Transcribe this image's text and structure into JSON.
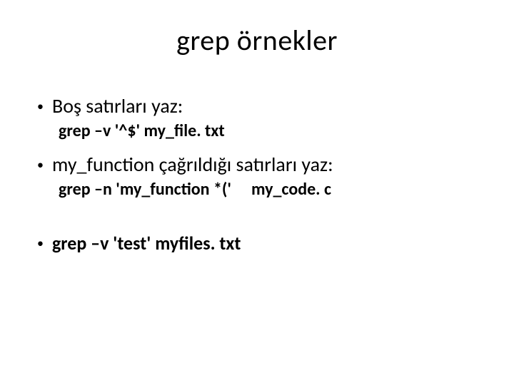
{
  "title": "grep örnekler",
  "items": [
    {
      "bullet": "Boş satırları yaz:",
      "sub": "grep –v '^$' my_file. txt",
      "bold": false
    },
    {
      "bullet": "my_function çağrıldığı satırları yaz:",
      "sub_prefix": "grep –n 'my_function *('",
      "sub_suffix": "my_code. c",
      "bold": false
    },
    {
      "bullet": "grep –v   'test' myfiles. txt",
      "bold": true
    }
  ]
}
